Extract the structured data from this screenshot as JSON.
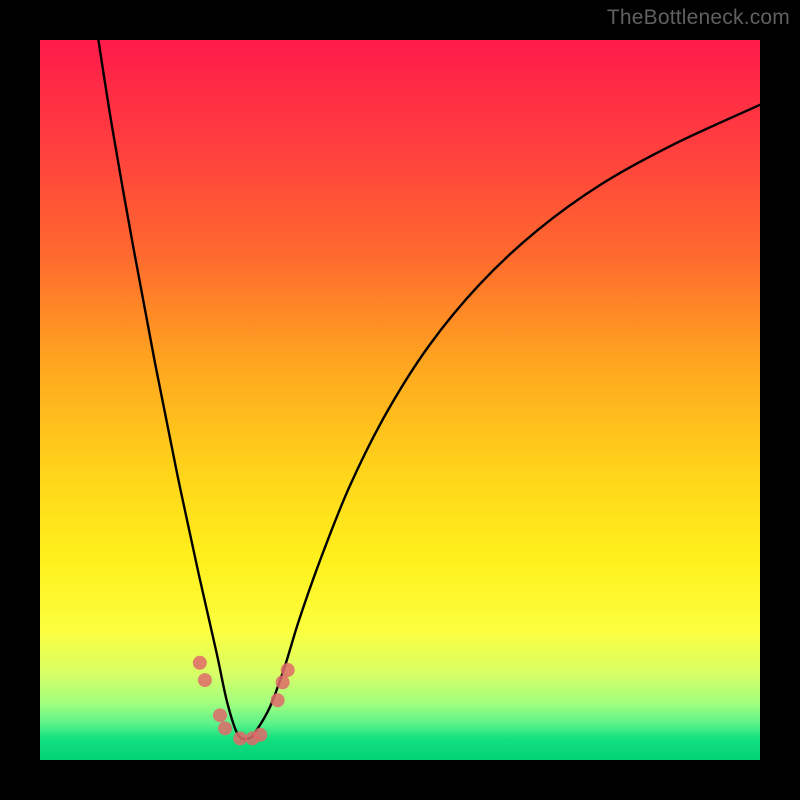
{
  "watermark": "TheBottleneck.com",
  "colors": {
    "frame": "#000000",
    "curve": "#000000",
    "marker": "#e06a6a",
    "gradient_stops": [
      "#ff1b4a",
      "#ff3f3e",
      "#ff6a2e",
      "#ffa61f",
      "#ffd41a",
      "#fff01c",
      "#fcff3f",
      "#d8ff66",
      "#a2ff7e",
      "#5cf28a",
      "#13e07f",
      "#04d277"
    ]
  },
  "chart_data": {
    "type": "line",
    "title": "",
    "xlabel": "",
    "ylabel": "",
    "xlim": [
      0,
      100
    ],
    "ylim": [
      0,
      100
    ],
    "note": "Axes carry no labels or tick marks. Values below are percentages of the plot area (0,0 = top-left of gradient, 100,100 = bottom-right). The curve depicts a V-shaped bottleneck profile with minimum near x≈27–30%. Markers are the pink dots clustered near the trough.",
    "series": [
      {
        "name": "bottleneck-curve",
        "x": [
          7.5,
          10,
          13,
          16,
          19,
          22,
          24.5,
          26,
          27.5,
          29,
          30,
          32,
          34,
          36,
          39,
          43,
          48,
          54,
          61,
          69,
          78,
          88,
          100
        ],
        "y": [
          -4,
          12,
          29,
          45,
          60,
          74,
          85,
          92,
          96.5,
          97,
          96,
          92.5,
          87,
          80.5,
          72,
          62,
          52,
          42.5,
          34,
          26.5,
          20,
          14.5,
          9
        ]
      }
    ],
    "markers": [
      {
        "x": 22.2,
        "y": 86.5
      },
      {
        "x": 22.9,
        "y": 88.9
      },
      {
        "x": 25.0,
        "y": 93.8
      },
      {
        "x": 25.7,
        "y": 95.6
      },
      {
        "x": 27.8,
        "y": 97.0
      },
      {
        "x": 29.5,
        "y": 97.0
      },
      {
        "x": 30.6,
        "y": 96.5
      },
      {
        "x": 33.0,
        "y": 91.7
      },
      {
        "x": 33.7,
        "y": 89.2
      },
      {
        "x": 34.4,
        "y": 87.5
      }
    ]
  }
}
